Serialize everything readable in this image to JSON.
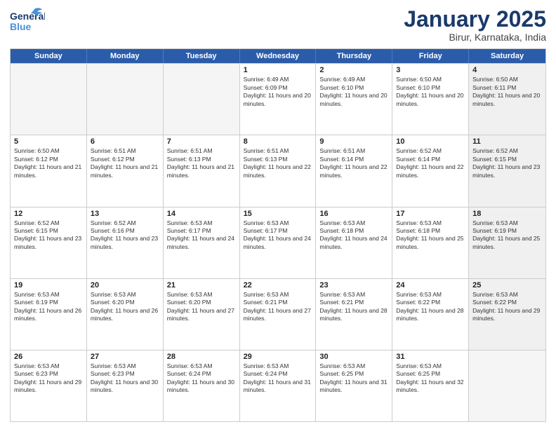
{
  "logo": {
    "line1": "General",
    "line2": "Blue"
  },
  "title": "January 2025",
  "location": "Birur, Karnataka, India",
  "days_of_week": [
    "Sunday",
    "Monday",
    "Tuesday",
    "Wednesday",
    "Thursday",
    "Friday",
    "Saturday"
  ],
  "weeks": [
    [
      {
        "day": "",
        "empty": true
      },
      {
        "day": "",
        "empty": true
      },
      {
        "day": "",
        "empty": true
      },
      {
        "day": "1",
        "sunrise": "6:49 AM",
        "sunset": "6:09 PM",
        "daylight": "11 hours and 20 minutes."
      },
      {
        "day": "2",
        "sunrise": "6:49 AM",
        "sunset": "6:10 PM",
        "daylight": "11 hours and 20 minutes."
      },
      {
        "day": "3",
        "sunrise": "6:50 AM",
        "sunset": "6:10 PM",
        "daylight": "11 hours and 20 minutes."
      },
      {
        "day": "4",
        "sunrise": "6:50 AM",
        "sunset": "6:11 PM",
        "daylight": "11 hours and 20 minutes.",
        "shaded": true
      }
    ],
    [
      {
        "day": "5",
        "sunrise": "6:50 AM",
        "sunset": "6:12 PM",
        "daylight": "11 hours and 21 minutes."
      },
      {
        "day": "6",
        "sunrise": "6:51 AM",
        "sunset": "6:12 PM",
        "daylight": "11 hours and 21 minutes."
      },
      {
        "day": "7",
        "sunrise": "6:51 AM",
        "sunset": "6:13 PM",
        "daylight": "11 hours and 21 minutes."
      },
      {
        "day": "8",
        "sunrise": "6:51 AM",
        "sunset": "6:13 PM",
        "daylight": "11 hours and 22 minutes."
      },
      {
        "day": "9",
        "sunrise": "6:51 AM",
        "sunset": "6:14 PM",
        "daylight": "11 hours and 22 minutes."
      },
      {
        "day": "10",
        "sunrise": "6:52 AM",
        "sunset": "6:14 PM",
        "daylight": "11 hours and 22 minutes."
      },
      {
        "day": "11",
        "sunrise": "6:52 AM",
        "sunset": "6:15 PM",
        "daylight": "11 hours and 23 minutes.",
        "shaded": true
      }
    ],
    [
      {
        "day": "12",
        "sunrise": "6:52 AM",
        "sunset": "6:15 PM",
        "daylight": "11 hours and 23 minutes."
      },
      {
        "day": "13",
        "sunrise": "6:52 AM",
        "sunset": "6:16 PM",
        "daylight": "11 hours and 23 minutes."
      },
      {
        "day": "14",
        "sunrise": "6:53 AM",
        "sunset": "6:17 PM",
        "daylight": "11 hours and 24 minutes."
      },
      {
        "day": "15",
        "sunrise": "6:53 AM",
        "sunset": "6:17 PM",
        "daylight": "11 hours and 24 minutes."
      },
      {
        "day": "16",
        "sunrise": "6:53 AM",
        "sunset": "6:18 PM",
        "daylight": "11 hours and 24 minutes."
      },
      {
        "day": "17",
        "sunrise": "6:53 AM",
        "sunset": "6:18 PM",
        "daylight": "11 hours and 25 minutes."
      },
      {
        "day": "18",
        "sunrise": "6:53 AM",
        "sunset": "6:19 PM",
        "daylight": "11 hours and 25 minutes.",
        "shaded": true
      }
    ],
    [
      {
        "day": "19",
        "sunrise": "6:53 AM",
        "sunset": "6:19 PM",
        "daylight": "11 hours and 26 minutes."
      },
      {
        "day": "20",
        "sunrise": "6:53 AM",
        "sunset": "6:20 PM",
        "daylight": "11 hours and 26 minutes."
      },
      {
        "day": "21",
        "sunrise": "6:53 AM",
        "sunset": "6:20 PM",
        "daylight": "11 hours and 27 minutes."
      },
      {
        "day": "22",
        "sunrise": "6:53 AM",
        "sunset": "6:21 PM",
        "daylight": "11 hours and 27 minutes."
      },
      {
        "day": "23",
        "sunrise": "6:53 AM",
        "sunset": "6:21 PM",
        "daylight": "11 hours and 28 minutes."
      },
      {
        "day": "24",
        "sunrise": "6:53 AM",
        "sunset": "6:22 PM",
        "daylight": "11 hours and 28 minutes."
      },
      {
        "day": "25",
        "sunrise": "6:53 AM",
        "sunset": "6:22 PM",
        "daylight": "11 hours and 29 minutes.",
        "shaded": true
      }
    ],
    [
      {
        "day": "26",
        "sunrise": "6:53 AM",
        "sunset": "6:23 PM",
        "daylight": "11 hours and 29 minutes."
      },
      {
        "day": "27",
        "sunrise": "6:53 AM",
        "sunset": "6:23 PM",
        "daylight": "11 hours and 30 minutes."
      },
      {
        "day": "28",
        "sunrise": "6:53 AM",
        "sunset": "6:24 PM",
        "daylight": "11 hours and 30 minutes."
      },
      {
        "day": "29",
        "sunrise": "6:53 AM",
        "sunset": "6:24 PM",
        "daylight": "11 hours and 31 minutes."
      },
      {
        "day": "30",
        "sunrise": "6:53 AM",
        "sunset": "6:25 PM",
        "daylight": "11 hours and 31 minutes."
      },
      {
        "day": "31",
        "sunrise": "6:53 AM",
        "sunset": "6:25 PM",
        "daylight": "11 hours and 32 minutes."
      },
      {
        "day": "",
        "empty": true,
        "shaded": true
      }
    ]
  ]
}
